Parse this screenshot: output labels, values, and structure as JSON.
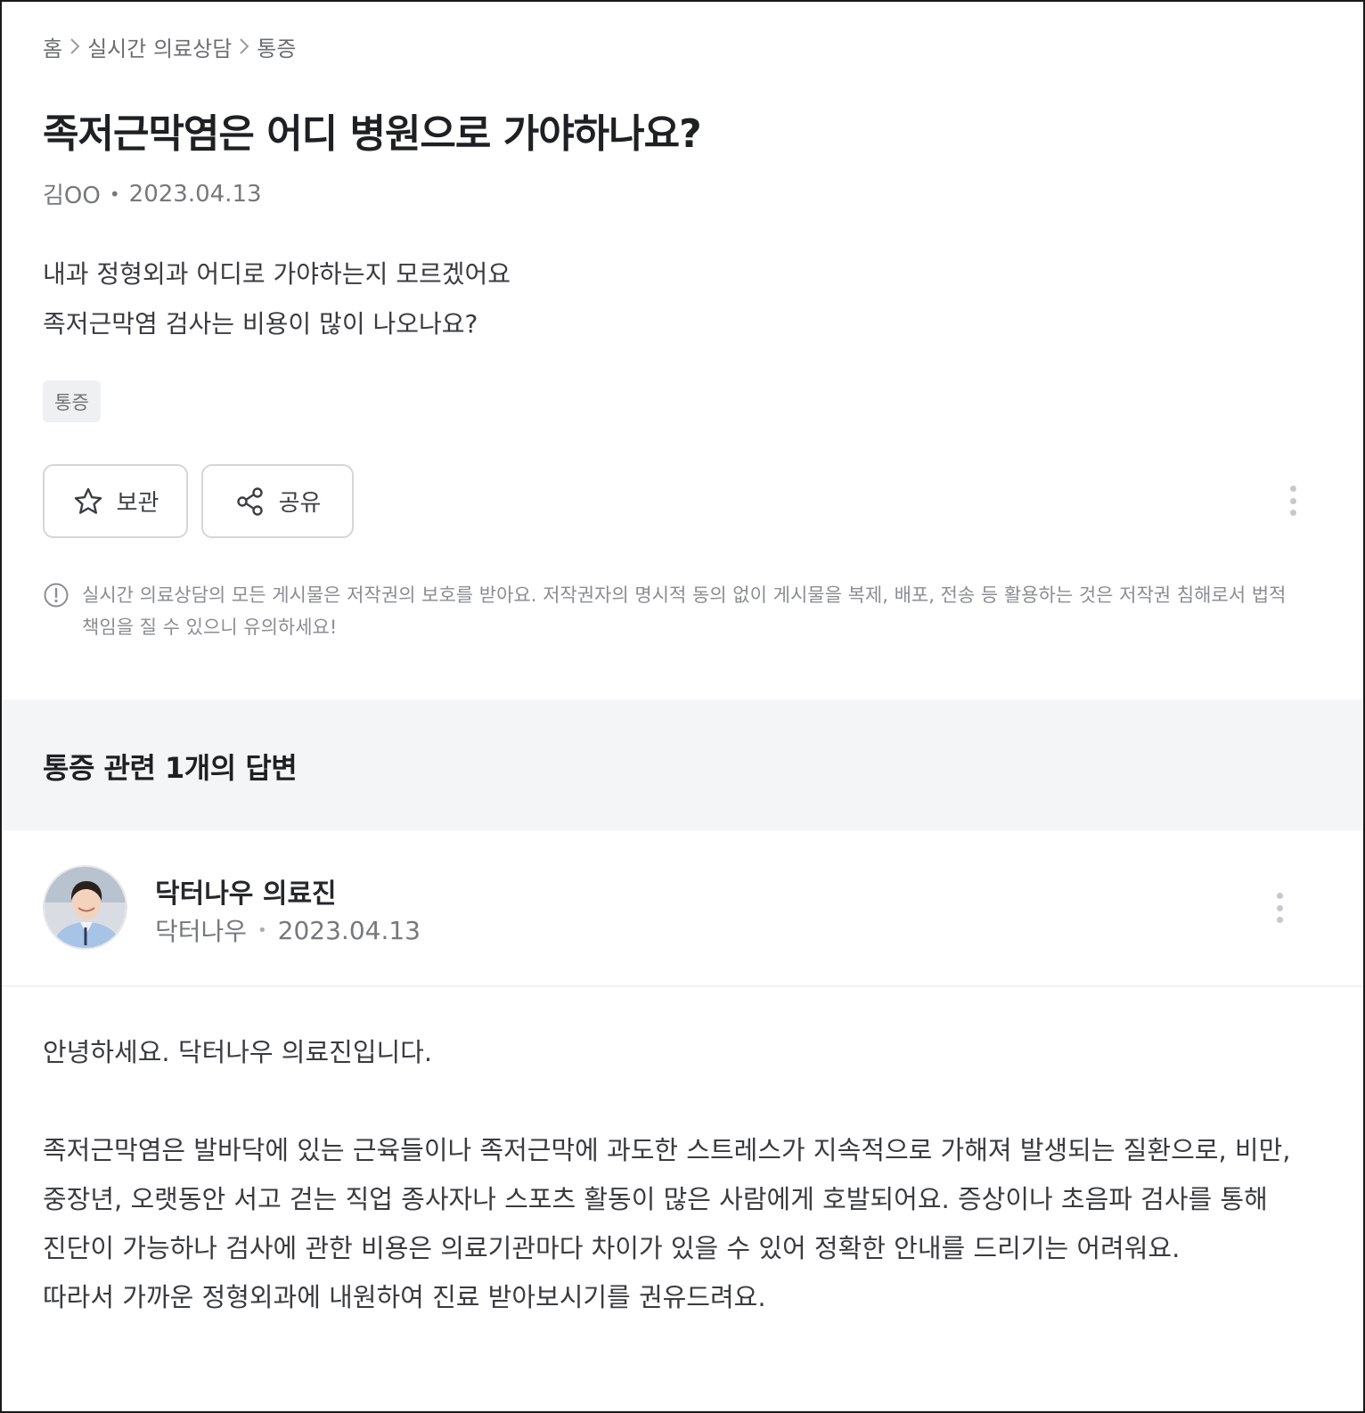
{
  "breadcrumb": {
    "home": "홈",
    "category": "실시간 의료상담",
    "current": "통증"
  },
  "post": {
    "title": "족저근막염은 어디 병원으로 가야하나요?",
    "author": "김OO",
    "date": "2023.04.13",
    "body_line1": "내과 정형외과 어디로 가야하는지 모르겠어요",
    "body_line2": "족저근막염 검사는 비용이 많이 나오나요?",
    "tag": "통증"
  },
  "actions": {
    "save_label": "보관",
    "share_label": "공유"
  },
  "notice": {
    "text": "실시간 의료상담의 모든 게시물은 저작권의 보호를 받아요. 저작권자의 명시적 동의 없이 게시물을 복제, 배포, 전송 등 활용하는 것은 저작권 침해로서 법적 책임을 질 수 있으니 유의하세요!"
  },
  "answers": {
    "heading": "통증 관련 1개의 답변",
    "items": [
      {
        "author_name": "닥터나우 의료진",
        "org": "닥터나우",
        "date": "2023.04.13",
        "greeting": "안녕하세요. 닥터나우 의료진입니다.",
        "para_line1": "족저근막염은 발바닥에 있는 근육들이나 족저근막에 과도한 스트레스가 지속적으로 가해져 발생되는 질환으로, 비만,",
        "para_line2": "중장년, 오랫동안 서고 걷는 직업 종사자나 스포츠 활동이 많은 사람에게 호발되어요. 증상이나 초음파 검사를 통해",
        "para_line3": "진단이 가능하나 검사에 관한 비용은 의료기관마다 차이가 있을 수 있어 정확한 안내를 드리기는 어려워요.",
        "para_line4": "따라서 가까운 정형외과에 내원하여 진료 받아보시기를 권유드려요."
      }
    ]
  },
  "icons": {
    "breadcrumb_separator": "chevron-right-icon",
    "save": "star-icon",
    "share": "share-icon",
    "more": "more-vertical-icon",
    "notice": "info-icon"
  }
}
